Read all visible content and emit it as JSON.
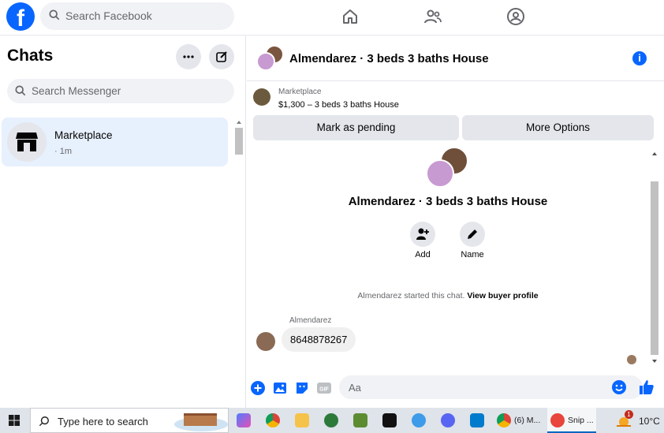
{
  "topbar": {
    "logo": "f",
    "search_placeholder": "Search Facebook",
    "nav_icons": [
      "home-icon",
      "friends-icon",
      "groups-icon"
    ]
  },
  "sidebar": {
    "title": "Chats",
    "search_placeholder": "Search Messenger",
    "chats": [
      {
        "name": "Marketplace",
        "time": "· 1m",
        "icon": "shop-icon"
      }
    ]
  },
  "conversation": {
    "title": "Almendarez · 3 beds 3 baths House",
    "listing": {
      "label": "Marketplace",
      "summary": "$1,300 – 3 beds 3 baths House"
    },
    "buttons": {
      "mark_pending": "Mark as pending",
      "more_options": "More Options"
    },
    "intro": {
      "title": "Almendarez · 3 beds 3 baths House",
      "add_label": "Add",
      "name_label": "Name"
    },
    "system_message": {
      "text": "Almendarez started this chat.",
      "link": "View buyer profile"
    },
    "messages": [
      {
        "sender": "Almendarez",
        "text": "8648878267"
      }
    ],
    "composer": {
      "placeholder": "Aa"
    }
  },
  "taskbar": {
    "search_placeholder": "Type here to search",
    "chrome_profile_label": "(6) M...",
    "snip_label": "Snip ...",
    "temperature": "10°C",
    "weather_badge": "1",
    "colors": {
      "accent": "#0067c0"
    }
  },
  "colors": {
    "facebook_blue": "#0866ff",
    "selected_chat_bg": "#e7f0fd",
    "button_gray": "#e4e6eb"
  }
}
